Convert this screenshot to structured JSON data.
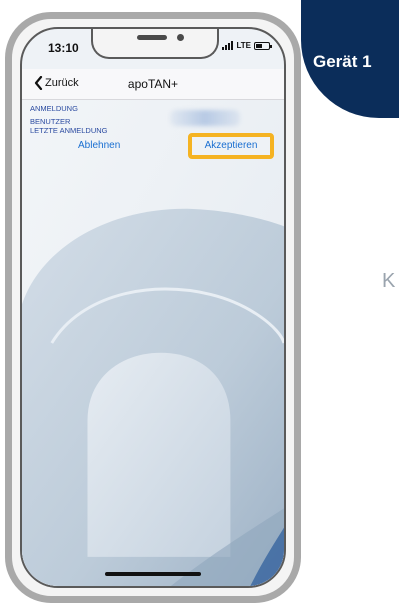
{
  "status_bar": {
    "time": "13:10",
    "network": "LTE"
  },
  "nav": {
    "back_label": "Zurück",
    "title": "apoTAN+"
  },
  "login_info": {
    "anmeldung_label": "ANMELDUNG",
    "benutzer_label": "BENUTZER",
    "letzte_anmeldung_label": "LETZTE ANMELDUNG"
  },
  "actions": {
    "reject_label": "Ablehnen",
    "accept_label": "Akzeptieren"
  },
  "device_badge": {
    "label": "Gerät 1"
  },
  "side_text": "K",
  "colors": {
    "badge_background": "#0b2d5a",
    "highlight": "#f5b322",
    "link_blue": "#1a6fd1",
    "label_blue": "#2a4aa0"
  }
}
